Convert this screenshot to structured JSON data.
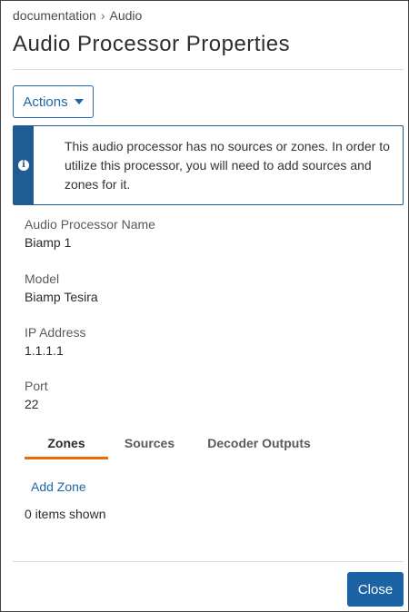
{
  "breadcrumb": {
    "items": [
      "documentation",
      "Audio"
    ],
    "separator": "›"
  },
  "title": "Audio Processor Properties",
  "actions": {
    "label": "Actions"
  },
  "alert": {
    "icon": "info-icon",
    "message": "This audio processor has no sources or zones. In order to utilize this processor, you will need to add sources and zones for it."
  },
  "fields": [
    {
      "label": "Audio Processor Name",
      "value": "Biamp 1"
    },
    {
      "label": "Model",
      "value": "Biamp Tesira"
    },
    {
      "label": "IP Address",
      "value": "1.1.1.1"
    },
    {
      "label": "Port",
      "value": "22"
    }
  ],
  "tabs": [
    {
      "label": "Zones",
      "active": true
    },
    {
      "label": "Sources",
      "active": false
    },
    {
      "label": "Decoder Outputs",
      "active": false
    }
  ],
  "zones": {
    "add_label": "Add Zone",
    "count_text": "0 items shown"
  },
  "footer": {
    "close_label": "Close"
  },
  "colors": {
    "accent": "#1c63a6",
    "alert": "#1f5c93",
    "active_tab": "#e86c0a"
  }
}
